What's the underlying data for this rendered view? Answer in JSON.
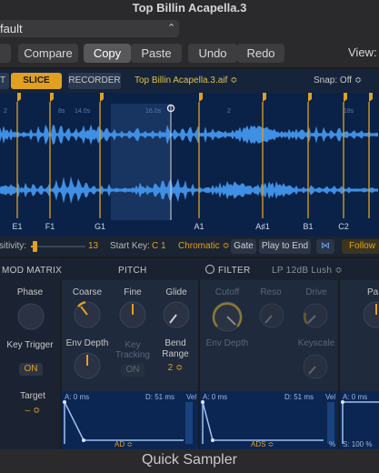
{
  "window": {
    "title": "Top Billin Acapella.3"
  },
  "preset": {
    "name": "fault",
    "chevron_icon": "chevron-updown-icon"
  },
  "toolbar": {
    "compare": "Compare",
    "copy": "Copy",
    "paste": "Paste",
    "undo": "Undo",
    "redo": "Redo",
    "view": "View:"
  },
  "header": {
    "mode_left": "T",
    "slice": "SLICE",
    "recorder": "RECORDER",
    "file": "Top Billin Acapella.3.aif ≎",
    "snap": "Snap: Off ≎"
  },
  "waveform": {
    "ruler_labels": [
      "2",
      "8s",
      "14.0s",
      "16.0s",
      "2",
      "18s"
    ],
    "markers": [
      "E1",
      "F1",
      "G1",
      "A1",
      "A♯1",
      "B1",
      "C2"
    ],
    "colors": {
      "background": "#0a2247",
      "wave": "#3f8fe4",
      "marker": "#e2a020"
    }
  },
  "controls": {
    "sensitivity_label": "sitivity:",
    "sensitivity_value": "13",
    "start_key_label": "Start Key:",
    "start_key_value": "C 1",
    "scale": "Chromatic ≎",
    "gate": "Gate",
    "play": "Play to End",
    "follow": "Follow"
  },
  "tabs": {
    "mod_matrix": "MOD MATRIX",
    "pitch": "PITCH",
    "filter": "FILTER",
    "filter_type": "LP 12dB Lush ≎"
  },
  "mod_panel": {
    "phase": "Phase",
    "key_trigger": "Key Trigger",
    "key_trigger_value": "ON",
    "target": "Target",
    "target_value": "– ≎"
  },
  "pitch_panel": {
    "coarse": "Coarse",
    "fine": "Fine",
    "glide": "Glide",
    "env_depth": "Env Depth",
    "key_tracking": "Key Tracking",
    "key_tracking_value": "ON",
    "bend_range": "Bend Range",
    "bend_range_value": "2 ≎"
  },
  "filter_panel": {
    "cutoff": "Cutoff",
    "reso": "Reso",
    "drive": "Drive",
    "env_depth": "Env Depth",
    "keyscale": "Keyscale"
  },
  "right_panel": {
    "label": "Pa"
  },
  "envelopes": {
    "pitch_a": "A: 0 ms",
    "pitch_d": "D: 51 ms",
    "pitch_vel": "Vel",
    "pitch_mode": "AD ≎",
    "filter_a": "A: 0 ms",
    "filter_d": "D: 51 ms",
    "filter_vel": "Vel",
    "filter_mode": "ADS ≎",
    "filter_pct": "%",
    "amp_a": "A: 0 ms",
    "amp_s": "S: 100 %"
  },
  "bottom": {
    "title": "Quick Sampler"
  }
}
